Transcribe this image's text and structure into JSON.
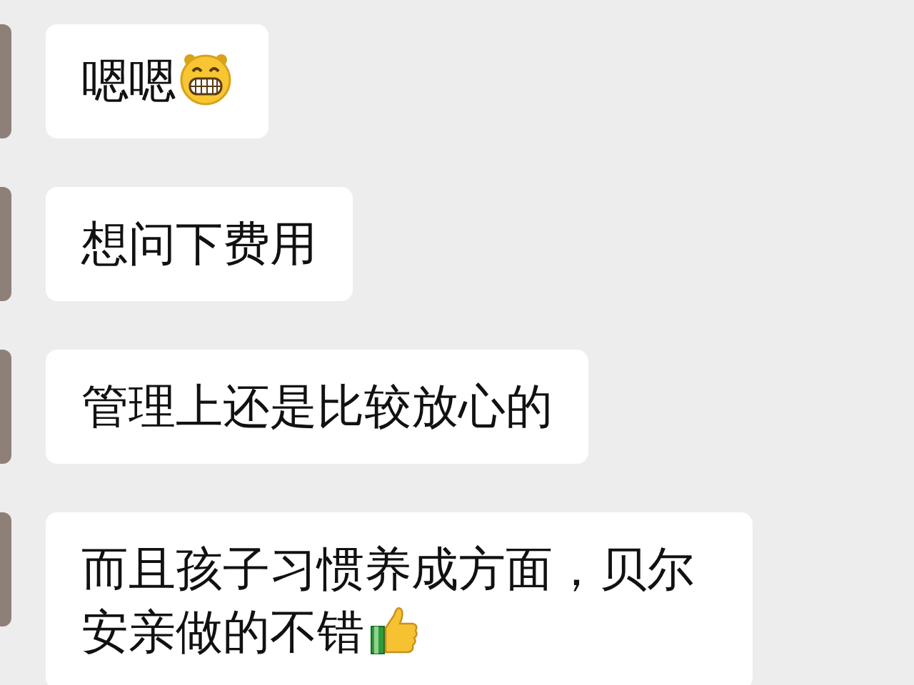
{
  "messages": [
    {
      "text": "嗯嗯",
      "kind": "grin"
    },
    {
      "text": "想问下费用"
    },
    {
      "text": "管理上还是比较放心的"
    },
    {
      "text": "而且孩子习惯养成方面，贝尔安亲做的不错",
      "kind": "thumbs_up"
    }
  ]
}
